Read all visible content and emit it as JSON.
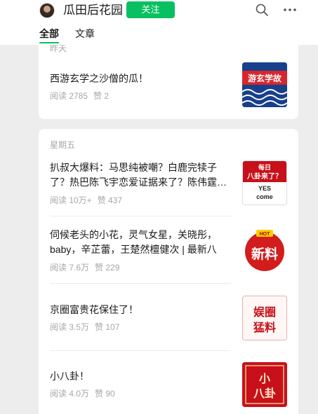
{
  "header": {
    "account_name": "瓜田后花园",
    "follow_label": "关注",
    "icons": [
      "avatar",
      "search-icon",
      "more-icon"
    ]
  },
  "tabs": [
    {
      "label": "全部",
      "active": true
    },
    {
      "label": "文章",
      "active": false
    }
  ],
  "groups": [
    {
      "day": "昨天",
      "articles": [
        {
          "title": "西游玄学之沙僧的瓜！",
          "reads": "阅读 2785",
          "likes": "赞 2",
          "thumb_text": "游玄学故"
        }
      ]
    },
    {
      "day": "星期五",
      "articles": [
        {
          "title": "扒叔大爆料：马思纯被嘲？白鹿完犊子了？热巴陈飞宇恋爱证据来了？陈伟霆…",
          "reads": "阅读 10万+",
          "likes": "赞 437",
          "thumb_text": {
            "l1": "每日",
            "l2": "八卦来了？",
            "l3": "YES",
            "l4": "come"
          }
        },
        {
          "title": "伺候老头的小花，灵气女星，关晓彤，baby，辛芷蕾，王楚然檀健次 | 最新八卦…",
          "reads": "阅读 7.6万",
          "likes": "赞 229",
          "thumb_text": {
            "badge": "HOT",
            "main": "新料"
          }
        },
        {
          "title": "京圈富贵花保住了！",
          "reads": "阅读 3.5万",
          "likes": "赞 107",
          "thumb_text": {
            "l1": "娱圈",
            "l2": "猛料"
          }
        },
        {
          "title": "小八卦！",
          "reads": "阅读 4.0万",
          "likes": "赞 90",
          "thumb_text": {
            "l1": "小",
            "l2": "八卦"
          }
        }
      ]
    }
  ],
  "colors": {
    "accent": "#07c160",
    "background": "#ededed",
    "card": "#ffffff",
    "meta_text": "#a7a7a7",
    "thumb_red": "#c8101a"
  }
}
